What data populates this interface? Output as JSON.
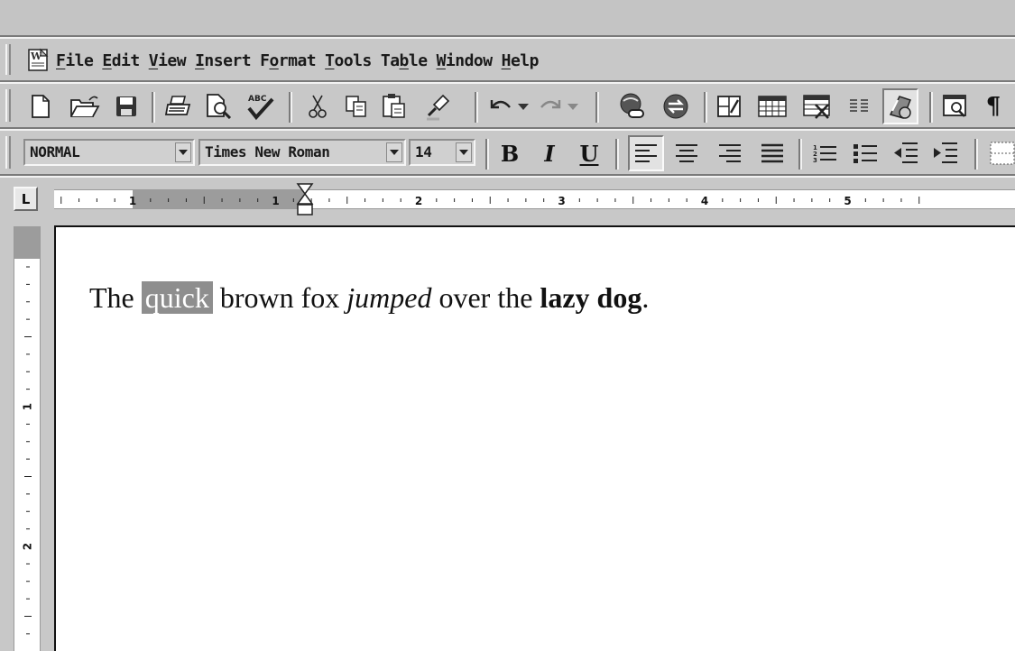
{
  "menubar": {
    "app_icon": "word-document-icon",
    "items": [
      {
        "label": "File",
        "accel": "F",
        "rest": "ile"
      },
      {
        "label": "Edit",
        "accel": "E",
        "rest": "dit"
      },
      {
        "label": "View",
        "accel": "V",
        "rest": "iew"
      },
      {
        "label": "Insert",
        "accel": "I",
        "rest": "nsert"
      },
      {
        "label": "Format",
        "pre": "F",
        "accel": "o",
        "rest": "rmat"
      },
      {
        "label": "Tools",
        "accel": "T",
        "rest": "ools"
      },
      {
        "label": "Table",
        "pre": "Ta",
        "accel": "b",
        "rest": "le"
      },
      {
        "label": "Window",
        "accel": "W",
        "rest": "indow"
      },
      {
        "label": "Help",
        "accel": "H",
        "rest": "elp"
      }
    ]
  },
  "standard_toolbar": {
    "buttons": [
      "new-document-icon",
      "open-folder-icon",
      "save-disk-icon",
      "print-icon",
      "print-preview-icon",
      "spelling-check-icon",
      "cut-scissors-icon",
      "copy-icon",
      "paste-icon",
      "format-painter-icon",
      "undo-icon",
      "undo-dropdown-icon",
      "redo-icon",
      "redo-dropdown-icon",
      "insert-hyperlink-icon",
      "web-toolbar-icon",
      "tables-borders-icon",
      "insert-table-icon",
      "insert-excel-icon",
      "columns-icon",
      "drawing-icon",
      "document-map-icon",
      "show-formatting-pilcrow-icon"
    ],
    "pilcrow": "¶"
  },
  "formatting_toolbar": {
    "style": "NORMAL",
    "font": "Times New Roman",
    "size": "14",
    "bold": "B",
    "italic": "I",
    "underline": "U",
    "active_alignment": "align-left"
  },
  "ruler": {
    "tab_selector": "L",
    "horizontal_labels": [
      "1",
      "1",
      "2",
      "3",
      "4",
      "5"
    ],
    "vertical_labels": [
      "1",
      "2"
    ]
  },
  "document": {
    "parts": {
      "p1": "The ",
      "selected": "quick",
      "p2": " brown fox ",
      "italic": "jumped",
      "p3": " over the ",
      "bold": "lazy dog",
      "p4": "."
    }
  }
}
